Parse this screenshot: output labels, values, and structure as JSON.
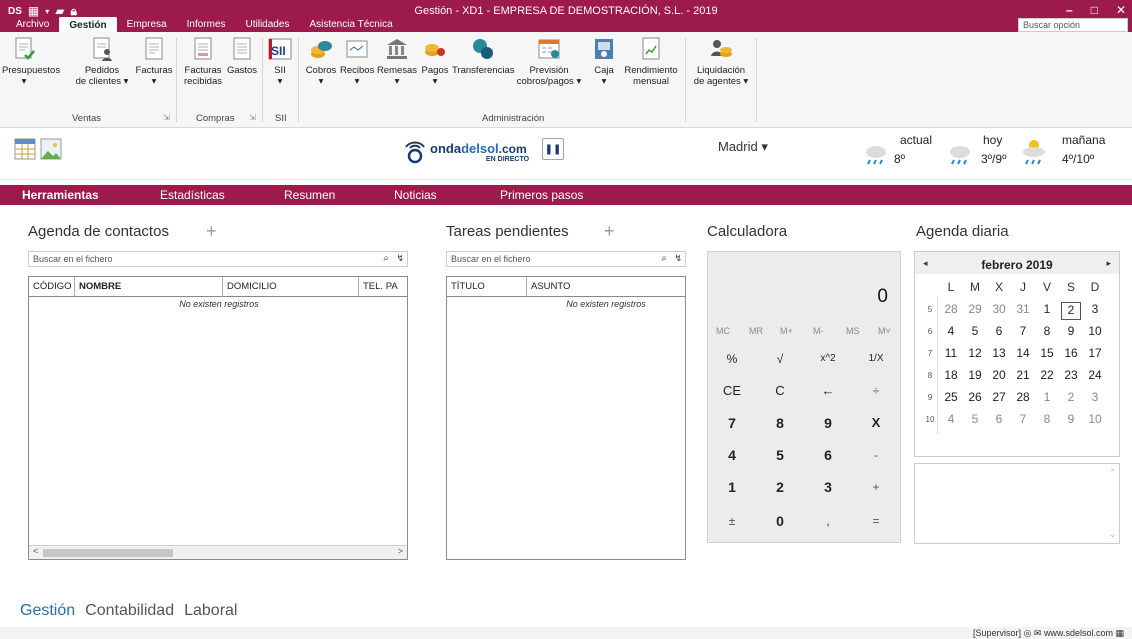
{
  "window": {
    "title": "Gestión - XD1 - EMPRESA DE DEMOSTRACIÓN, S.L. - 2019",
    "qat_logo": "DS",
    "minimize": "–",
    "maximize": "□",
    "close": "✕"
  },
  "menu": {
    "tabs": [
      "Archivo",
      "Gestión",
      "Empresa",
      "Informes",
      "Utilidades",
      "Asistencia Técnica"
    ],
    "active": "Gestión",
    "search_placeholder": "Buscar opción"
  },
  "ribbon": {
    "buttons": [
      {
        "label": "Presupuestos",
        "label2": "▾"
      },
      {
        "label": "Pedidos",
        "label2": "de clientes ▾"
      },
      {
        "label": "Facturas",
        "label2": "▾"
      },
      {
        "label": "Facturas",
        "label2": "recibidas"
      },
      {
        "label": "Gastos",
        "label2": ""
      },
      {
        "label": "SII",
        "label2": "▾"
      },
      {
        "label": "Cobros",
        "label2": "▾"
      },
      {
        "label": "Recibos",
        "label2": "▾"
      },
      {
        "label": "Remesas",
        "label2": "▾"
      },
      {
        "label": "Pagos",
        "label2": "▾"
      },
      {
        "label": "Transferencias",
        "label2": ""
      },
      {
        "label": "Previsión",
        "label2": "cobros/pagos ▾"
      },
      {
        "label": "Caja",
        "label2": "▾"
      },
      {
        "label": "Rendimiento",
        "label2": "mensual"
      },
      {
        "label": "Liquidación",
        "label2": "de agentes ▾"
      }
    ],
    "groups": [
      "Ventas",
      "Compras",
      "SII",
      "Administración"
    ]
  },
  "infobar": {
    "radio_logo_a": "onda",
    "radio_logo_b": "delsol",
    "radio_logo_c": ".com",
    "radio_sub": "EN DIRECTO",
    "pause": "❚❚",
    "city": "Madrid ▾",
    "weather": [
      {
        "label": "actual",
        "temp": "8º"
      },
      {
        "label": "hoy",
        "temp": "3º/9º"
      },
      {
        "label": "mañana",
        "temp": "4º/10º"
      }
    ]
  },
  "nav": {
    "items": [
      "Herramientas",
      "Estadísticas",
      "Resumen",
      "Noticias",
      "Primeros pasos"
    ],
    "active": "Herramientas"
  },
  "contacts": {
    "title": "Agenda de contactos",
    "add": "+",
    "search_placeholder": "Buscar en el fichero",
    "columns": [
      "CÓDIGO",
      "NOMBRE",
      "DOMICILIO",
      "TEL. PA"
    ],
    "empty": "No existen registros"
  },
  "tasks": {
    "title": "Tareas pendientes",
    "add": "+",
    "search_placeholder": "Buscar en el fichero",
    "columns": [
      "TÍTULO",
      "ASUNTO"
    ],
    "empty": "No existen registros"
  },
  "calculator": {
    "title": "Calculadora",
    "display": "0",
    "memory": [
      "MC",
      "MR",
      "M+",
      "M-",
      "MS",
      "M˅"
    ],
    "rows": [
      [
        "%",
        "√",
        "x^2",
        "1/X"
      ],
      [
        "CE",
        "C",
        "←",
        "÷"
      ],
      [
        "7",
        "8",
        "9",
        "X"
      ],
      [
        "4",
        "5",
        "6",
        "-"
      ],
      [
        "1",
        "2",
        "3",
        "+"
      ],
      [
        "±",
        "0",
        ",",
        "="
      ]
    ]
  },
  "calendar": {
    "title": "Agenda diaria",
    "month": "febrero 2019",
    "prev": "◂",
    "next": "▸",
    "dow": [
      "L",
      "M",
      "X",
      "J",
      "V",
      "S",
      "D"
    ],
    "weeks": [
      {
        "wk": "5",
        "days": [
          "28",
          "29",
          "30",
          "31",
          "1",
          "2",
          "3"
        ]
      },
      {
        "wk": "6",
        "days": [
          "4",
          "5",
          "6",
          "7",
          "8",
          "9",
          "10"
        ]
      },
      {
        "wk": "7",
        "days": [
          "11",
          "12",
          "13",
          "14",
          "15",
          "16",
          "17"
        ]
      },
      {
        "wk": "8",
        "days": [
          "18",
          "19",
          "20",
          "21",
          "22",
          "23",
          "24"
        ]
      },
      {
        "wk": "9",
        "days": [
          "25",
          "26",
          "27",
          "28",
          "1",
          "2",
          "3"
        ]
      },
      {
        "wk": "10",
        "days": [
          "4",
          "5",
          "6",
          "7",
          "8",
          "9",
          "10"
        ]
      }
    ],
    "today": "2"
  },
  "bottom": {
    "tabs": [
      "Gestión",
      "Contabilidad",
      "Laboral"
    ],
    "active": "Gestión"
  },
  "status": {
    "user": "[Supervisor]",
    "site": "www.sdelsol.com"
  },
  "colors": {
    "brand": "#9c1a4c",
    "accent_link": "#2c6ea3"
  }
}
